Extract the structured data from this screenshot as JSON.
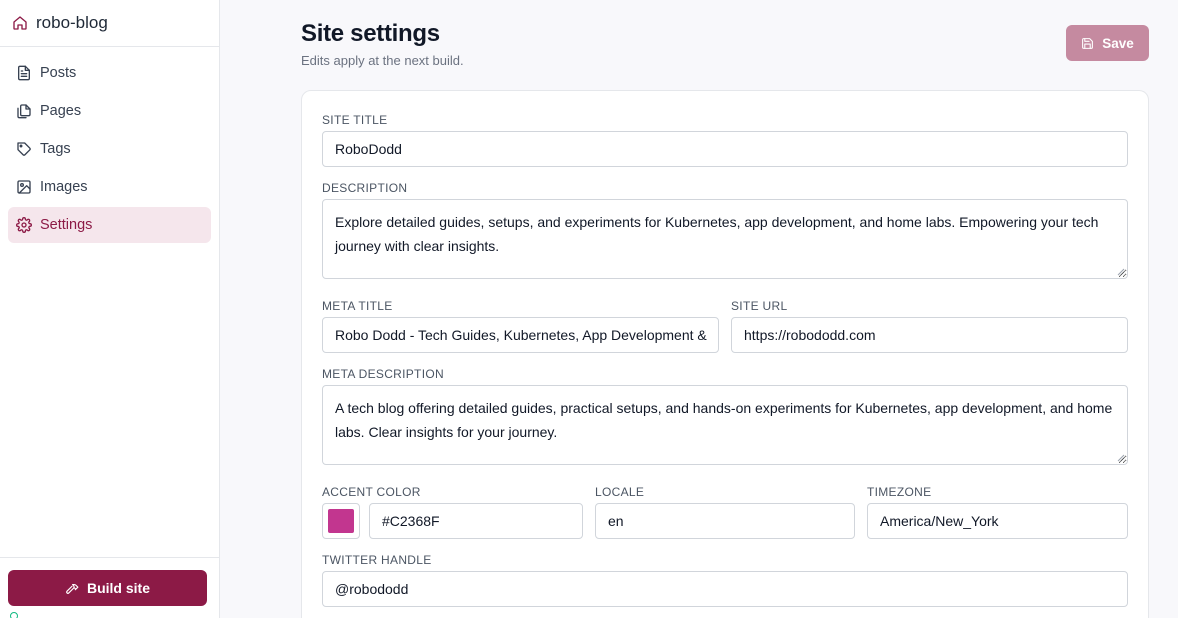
{
  "app": {
    "name": "robo-blog",
    "brand_icon": "house-icon"
  },
  "sidebar": {
    "items": [
      {
        "label": "Posts",
        "icon": "file-text-icon",
        "active": false
      },
      {
        "label": "Pages",
        "icon": "files-icon",
        "active": false
      },
      {
        "label": "Tags",
        "icon": "tag-icon",
        "active": false
      },
      {
        "label": "Images",
        "icon": "image-icon",
        "active": false
      },
      {
        "label": "Settings",
        "icon": "gear-icon",
        "active": true
      }
    ],
    "build_label": "Build site",
    "build_icon": "hammer-icon"
  },
  "header": {
    "title": "Site settings",
    "subtitle": "Edits apply at the next build.",
    "save_label": "Save",
    "save_icon": "floppy-disk-icon"
  },
  "form": {
    "site_title": {
      "label": "SITE TITLE",
      "value": "RoboDodd"
    },
    "description": {
      "label": "DESCRIPTION",
      "value": "Explore detailed guides, setups, and experiments for Kubernetes, app development, and home labs. Empowering your tech journey with clear insights."
    },
    "meta_title": {
      "label": "META TITLE",
      "value": "Robo Dodd - Tech Guides, Kubernetes, App Development &"
    },
    "site_url": {
      "label": "SITE URL",
      "value": "https://robododd.com"
    },
    "meta_description": {
      "label": "META DESCRIPTION",
      "value": "A tech blog offering detailed guides, practical setups, and hands-on experiments for Kubernetes, app development, and home labs. Clear insights for your journey."
    },
    "accent_color": {
      "label": "ACCENT COLOR",
      "value": "#C2368F"
    },
    "locale": {
      "label": "LOCALE",
      "value": "en"
    },
    "timezone": {
      "label": "TIMEZONE",
      "value": "America/New_York"
    },
    "twitter_handle": {
      "label": "TWITTER HANDLE",
      "value": "@robododd"
    }
  },
  "colors": {
    "brand": "#8c1a46",
    "save_disabled": "#c58aa0",
    "active_nav_bg": "#f5e6ec",
    "accent_swatch": "#C2368F"
  }
}
